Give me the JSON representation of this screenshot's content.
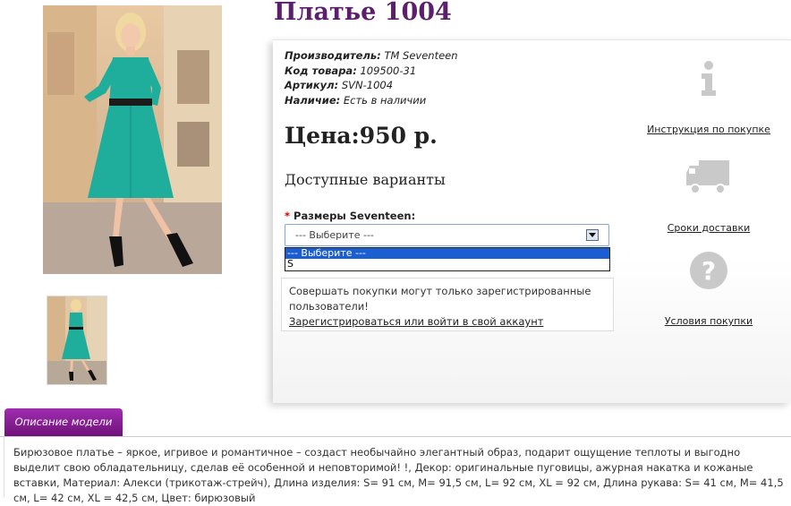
{
  "product": {
    "title": "Платье 1004",
    "manufacturer_label": "Производитель:",
    "manufacturer_value": "TM Seventeen",
    "code_label": "Код товара:",
    "code_value": "109500-31",
    "article_label": "Артикул:",
    "article_value": "SVN-1004",
    "availability_label": "Наличие:",
    "availability_value": "Есть в наличии",
    "price": "Цена:950 р.",
    "variants_heading": "Доступные варианты"
  },
  "size_select": {
    "required_mark": "*",
    "label": "Размеры Seventeen:",
    "value": "--- Выберите ---",
    "options": [
      "--- Выберите ---",
      "S"
    ]
  },
  "notice": {
    "text": "Совершать покупки могут только зарегистрированные пользователи!",
    "link": "Зарегистрироваться или войти в свой аккаунт"
  },
  "side_links": [
    {
      "icon": "info-icon",
      "label": "Инструкция по покупке"
    },
    {
      "icon": "truck-icon",
      "label": "Сроки доставки"
    },
    {
      "icon": "question-icon",
      "label": "Условия покупки"
    }
  ],
  "tabs": {
    "description": "Описание модели"
  },
  "description": "Бирюзовое платье – яркое, игривое и романтичное – создаст необычайно элегантный образ, подарит ощущение теплоты и выгодно выделит свою обладательницу, сделав её особенной и неповторимой! !, Декор: оригинальные пуговицы, ажурная накатка и кожаные вставки, Материал: Алекси (трикотаж-стрейч), Длина изделия: S= 91 см, M= 91,5 см, L= 92 см, XL = 92 см, Длина рукава: S= 41 см, M= 41,5 см, L= 42 см, XL = 42,5 см, Цвет: бирюзовый",
  "colors": {
    "title": "#5b1f6b",
    "tab": "#8a1f9a",
    "dress": "#1fae9c",
    "selection": "#1a5ed1"
  }
}
